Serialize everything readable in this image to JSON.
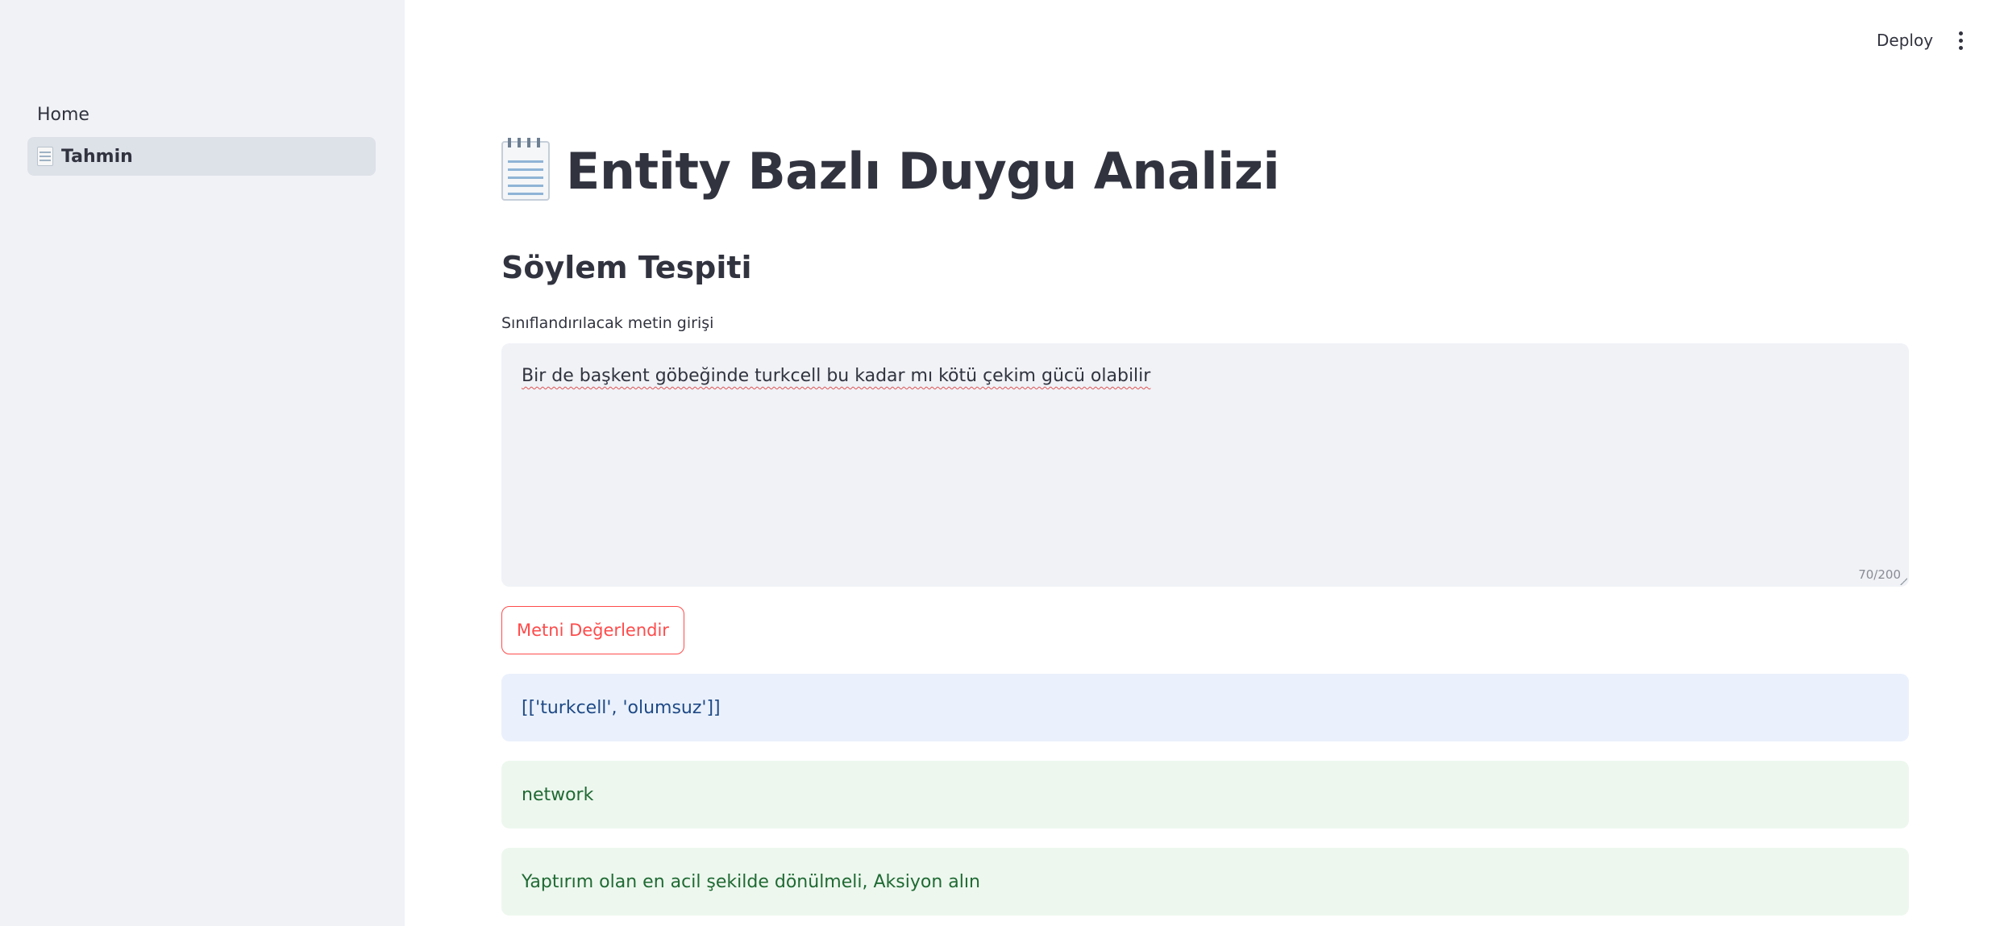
{
  "sidebar": {
    "items": [
      {
        "label": "Home",
        "icon": "",
        "active": false
      },
      {
        "label": "Tahmin",
        "icon": "notepad-icon",
        "active": true
      }
    ]
  },
  "header": {
    "deploy_label": "Deploy",
    "menu_icon": "kebab-menu-icon"
  },
  "main": {
    "title": "Entity Bazlı Duygu Analizi",
    "title_icon": "notepad-icon",
    "section_title": "Söylem Tespiti",
    "input": {
      "label": "Sınıflandırılacak metin girişi",
      "value": "Bir de başkent göbeğinde turkcell bu kadar mı kötü çekim gücü olabilir",
      "char_count": "70/200"
    },
    "button_label": "Metni Değerlendir",
    "results": {
      "info": "[['turkcell', 'olumsuz']]",
      "category": "network",
      "action": "Yaptırım olan en acil şekilde dönülmeli, Aksiyon alın"
    }
  },
  "colors": {
    "accent": "#ff4b4b",
    "sidebar_bg": "#f0f2f6",
    "info_bg": "#eaf1fc",
    "success_bg": "#edf7ee"
  }
}
